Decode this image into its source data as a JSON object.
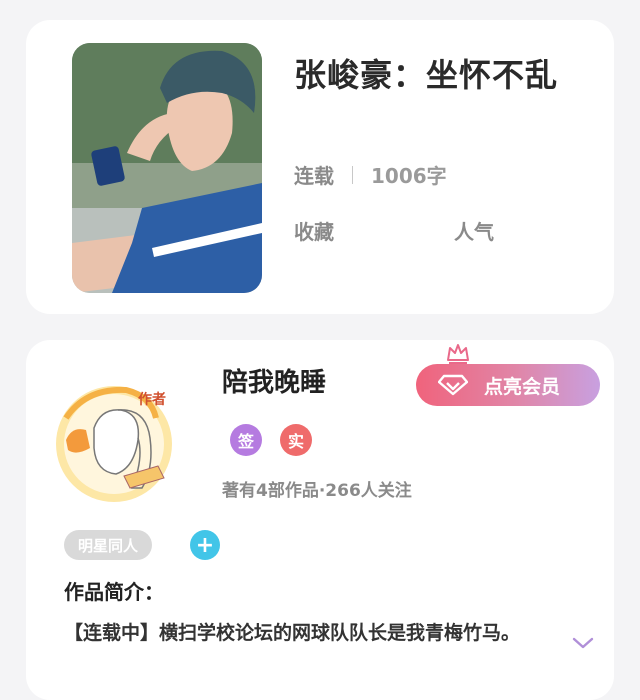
{
  "book": {
    "title": "张峻豪：坐怀不乱",
    "status": "连载",
    "word_count": "1006字",
    "collect_label": "收藏",
    "popularity_label": "人气"
  },
  "author": {
    "name": "陪我晚睡",
    "badge_sign": "签",
    "badge_real": "实",
    "stats": "著有4部作品·266人关注",
    "avatar_caption": "作者"
  },
  "vip": {
    "label": "点亮会员"
  },
  "tags": [
    "明星同人"
  ],
  "add_tag_symbol": "+",
  "intro": {
    "title": "作品简介：",
    "text": "【连载中】横扫学校论坛的网球队队长是我青梅竹马。"
  },
  "colors": {
    "badge_sign": "#b57be0",
    "badge_real": "#ef6b6b",
    "add_tag": "#42c5e8",
    "vip_gradient_start": "#f0637c",
    "vip_gradient_end": "#c8a0e0",
    "expand_arrow": "#b08fd8"
  },
  "icons": {
    "crown": "crown-icon",
    "diamond": "diamond-icon",
    "expand": "chevron-down-icon"
  }
}
